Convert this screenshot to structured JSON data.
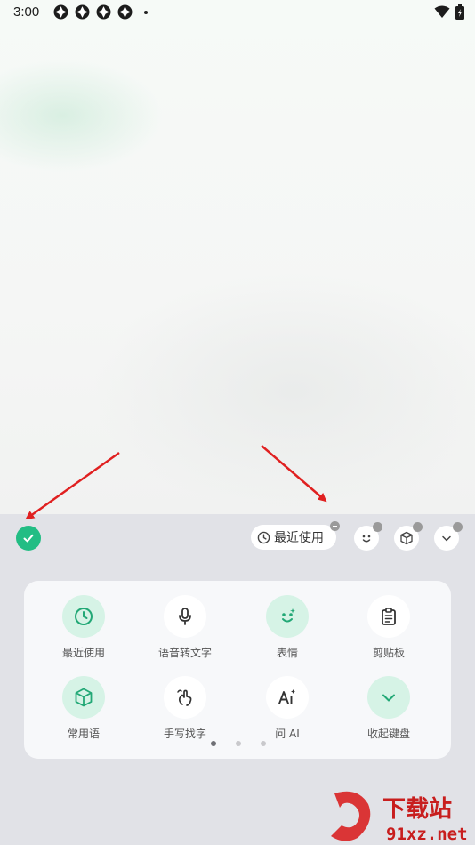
{
  "status_bar": {
    "time": "3:00",
    "notification_icons": [
      "app-notification-icon",
      "app-notification-icon",
      "app-notification-icon",
      "app-notification-icon"
    ],
    "right_icons": [
      "wifi-icon",
      "battery-icon"
    ]
  },
  "toolbar": {
    "recent_chip_label": "最近使用",
    "tools": [
      "emoji-face-icon",
      "box-icon",
      "collapse-check-icon"
    ]
  },
  "panel": {
    "items": [
      {
        "label": "最近使用",
        "icon": "clock-icon",
        "style": "green"
      },
      {
        "label": "语音转文字",
        "icon": "microphone-icon",
        "style": "white"
      },
      {
        "label": "表情",
        "icon": "emoji-face-icon",
        "style": "green"
      },
      {
        "label": "剪贴板",
        "icon": "clipboard-icon",
        "style": "white"
      },
      {
        "label": "常用语",
        "icon": "box-icon",
        "style": "green"
      },
      {
        "label": "手写找字",
        "icon": "handwriting-icon",
        "style": "white"
      },
      {
        "label": "问 AI",
        "icon": "ai-icon",
        "style": "white"
      },
      {
        "label": "收起键盘",
        "icon": "chevron-down-icon",
        "style": "green"
      }
    ],
    "page_indicator": {
      "pages": 3,
      "current": 1
    }
  },
  "watermark": {
    "title": "下载站",
    "domain": "91xz.net"
  },
  "colors": {
    "accent": "#22bd84",
    "accent_light": "#d6f3e6",
    "annotation": "#e02020"
  }
}
